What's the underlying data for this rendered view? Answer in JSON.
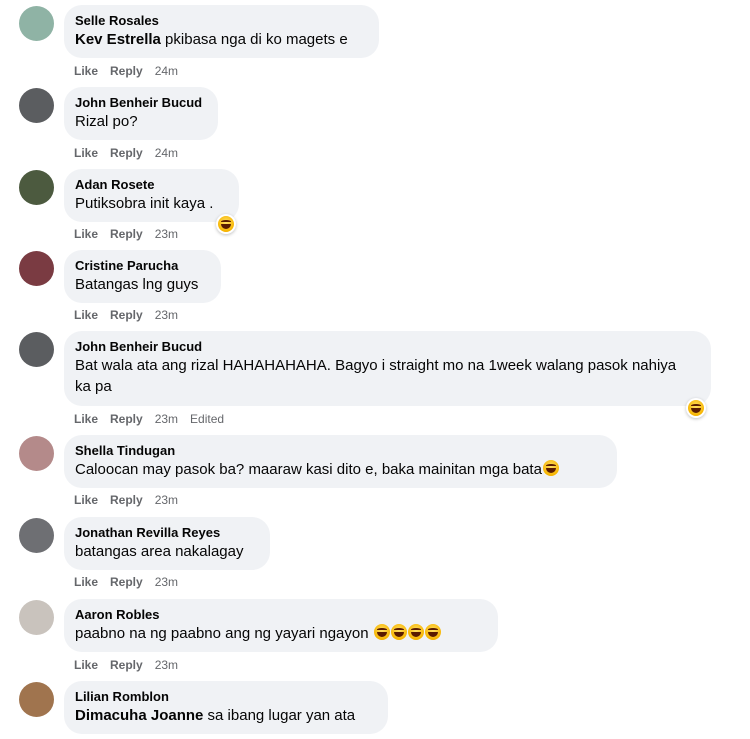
{
  "comments": [
    {
      "name": "Selle Rosales",
      "mention": "Kev Estrella",
      "text": " pkibasa nga di ko magets e",
      "like": "Like",
      "reply": "Reply",
      "time": "24m",
      "avatar": "#8fb3a5"
    },
    {
      "name": "John Benheir Bucud",
      "text": "Rizal po?",
      "like": "Like",
      "reply": "Reply",
      "time": "24m",
      "avatar": "#5b5d60"
    },
    {
      "name": "Adan Rosete",
      "text": "Putiksobra init kaya .",
      "like": "Like",
      "reply": "Reply",
      "time": "23m",
      "avatar": "#4c5a3f",
      "reaction": "laughing-emoji"
    },
    {
      "name": "Cristine Parucha",
      "text": "Batangas lng guys",
      "like": "Like",
      "reply": "Reply",
      "time": "23m",
      "avatar": "#7a3b42"
    },
    {
      "name": "John Benheir Bucud",
      "text": "Bat wala ata ang rizal HAHAHAHAHA. Bagyo i straight mo na 1week walang pasok nahiya ka pa",
      "like": "Like",
      "reply": "Reply",
      "time": "23m",
      "edited": "Edited",
      "avatar": "#5b5d60",
      "reaction": "laughing-emoji"
    },
    {
      "name": "Shella Tindugan",
      "text": "Caloocan may pasok ba? maaraw kasi dito e, baka mainitan mga bata",
      "like": "Like",
      "reply": "Reply",
      "time": "23m",
      "avatar": "#b48a8a",
      "emoji": "grinning-sweat-emoji"
    },
    {
      "name": "Jonathan Revilla Reyes",
      "text": "batangas area nakalagay",
      "like": "Like",
      "reply": "Reply",
      "time": "23m",
      "avatar": "#6e6f73"
    },
    {
      "name": "Aaron Robles",
      "text": "paabno na ng paabno ang ng yayari ngayon",
      "like": "Like",
      "reply": "Reply",
      "time": "23m",
      "avatar": "#c9c3bd",
      "emoji_count": 4
    },
    {
      "name": "Lilian Romblon",
      "mention": "Dimacuha Joanne",
      "text": " sa ibang lugar yan ata",
      "avatar": "#a0744e"
    }
  ]
}
